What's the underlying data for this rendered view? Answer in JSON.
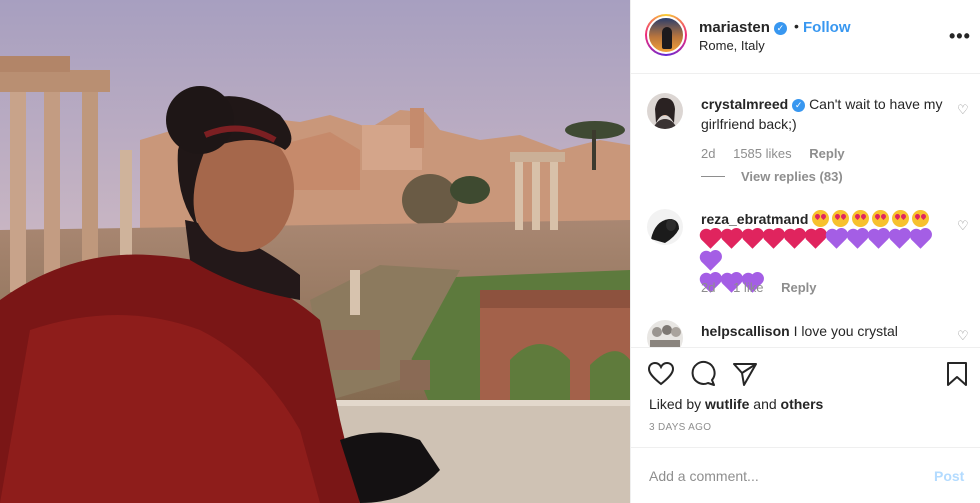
{
  "post": {
    "username": "mariasten",
    "verified": true,
    "separator": "•",
    "follow_label": "Follow",
    "location": "Rome, Italy",
    "more_icon": "more-options-icon"
  },
  "comments": [
    {
      "username": "crystalmreed",
      "verified": true,
      "text": "Can't wait to have my girlfriend back;)",
      "age": "2d",
      "likes": "1585 likes",
      "reply_label": "Reply",
      "view_replies": "View replies (83)"
    },
    {
      "username": "reza_ebratmand",
      "verified": false,
      "emoji_text": "😍😍😍😍😍😍❤️❤️❤️❤️❤️❤️💜💜💜💜💜💜💜💜💜",
      "age": "2d",
      "likes": "1 like",
      "reply_label": "Reply"
    },
    {
      "username": "helpscallison",
      "verified": false,
      "text": "I love you crystal"
    }
  ],
  "actions": {
    "like_icon": "heart-icon",
    "comment_icon": "comment-icon",
    "share_icon": "share-icon",
    "save_icon": "bookmark-icon",
    "liked_by_prefix": "Liked by",
    "liked_by_user": "wutlife",
    "liked_by_and": "and",
    "liked_by_others": "others",
    "timestamp": "3 DAYS AGO"
  },
  "add_comment": {
    "placeholder": "Add a comment...",
    "post_label": "Post"
  },
  "colors": {
    "accent": "#3897f0",
    "post_disabled": "#b3dbff",
    "muted": "#8e8e8e",
    "text": "#262626"
  }
}
